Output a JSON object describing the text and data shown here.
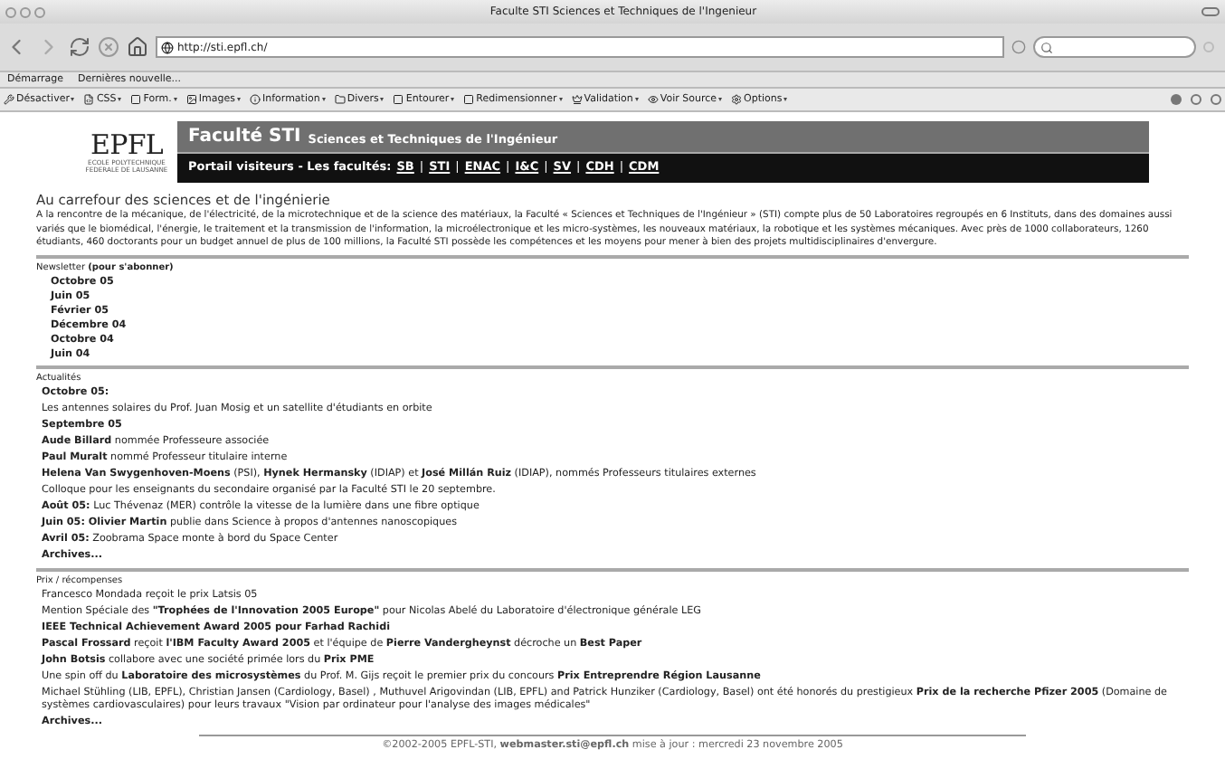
{
  "window": {
    "title": "Faculte STI Sciences et Techniques de l'Ingenieur"
  },
  "toolbar": {
    "url": "http://sti.epfl.ch/"
  },
  "bookmarks": [
    "Démarrage",
    "Dernières nouvelle..."
  ],
  "dev_toolbar": [
    "Désactiver",
    "CSS",
    "Form.",
    "Images",
    "Information",
    "Divers",
    "Entourer",
    "Redimensionner",
    "Validation",
    "Voir Source",
    "Options"
  ],
  "header": {
    "logo": "EPFL",
    "logo_caption": [
      "ECOLE POLYTECHNIQUE",
      "FEDERALE DE LAUSANNE"
    ],
    "title": "Faculté STI",
    "subtitle": "Sciences et Techniques de l'Ingénieur",
    "portal": "Portail visiteurs - Les facultés:",
    "links": [
      "SB",
      "STI",
      "ENAC",
      "I&C",
      "SV",
      "CDH",
      "CDM"
    ],
    "separators": [
      "|",
      "|",
      "|",
      "|",
      "|",
      "|"
    ]
  },
  "intro": {
    "heading": "Au carrefour des sciences et de l'ingénierie",
    "text": "A la rencontre de la mécanique, de l'électricité, de la microtechnique et de la science des matériaux, la Faculté « Sciences et Techniques de l'Ingénieur » (STI) compte plus de 50 Laboratoires regroupés en 6 Instituts, dans des domaines aussi variés que le biomédical, l'énergie, le traitement et la transmission de l'information, la microélectronique et les micro-systèmes, les nouveaux matériaux, la robotique et les systèmes mécaniques. Avec près de 1000 collaborateurs, 1260 étudiants, 460 doctorants pour un budget annuel de plus de 100 millions, la Faculté STI possède les compétences et les moyens pour mener à bien des projets multidisciplinaires d'envergure."
  },
  "sections": [
    {
      "title": "Newsletter **(pour s'abonner)**",
      "items": [
        {
          "kind": "link",
          "text": "Octobre 05"
        },
        {
          "kind": "link",
          "text": "Juin 05"
        },
        {
          "kind": "link",
          "text": "Février 05"
        },
        {
          "kind": "link",
          "text": "Décembre 04"
        },
        {
          "kind": "link",
          "text": "Octobre 04"
        },
        {
          "kind": "link",
          "text": "Juin 04"
        }
      ]
    },
    {
      "title": "Actualités",
      "items": [
        {
          "kind": "heading",
          "text": "**Octobre 05:**"
        },
        {
          "kind": "news",
          "text": "Les antennes solaires du Prof. Juan Mosig et un satellite d'étudiants en orbite"
        },
        {
          "kind": "heading",
          "text": "**Septembre 05**"
        },
        {
          "kind": "news",
          "text": "**Aude Billard** nommée Professeure associée"
        },
        {
          "kind": "news",
          "text": "**Paul Muralt** nommé Professeur titulaire interne"
        },
        {
          "kind": "news",
          "text": "**Helena Van Swygenhoven-Moens** (PSI), **Hynek Hermansky** (IDIAP) et **José Millán Ruiz** (IDIAP), nommés Professeurs titulaires externes"
        },
        {
          "kind": "news",
          "text": "Colloque pour les enseignants du secondaire organisé par la Faculté STI le 20 septembre."
        },
        {
          "kind": "news",
          "text": "**Août 05:** Luc Thévenaz (MER) contrôle la vitesse de la lumière dans une fibre optique"
        },
        {
          "kind": "news",
          "text": "**Juin 05: Olivier Martin** publie dans Science à propos d'antennes nanoscopiques"
        },
        {
          "kind": "news",
          "text": "**Avril 05:** Zoobrama Space monte à bord du Space Center"
        },
        {
          "kind": "archive",
          "text": "**Archives...**"
        }
      ]
    },
    {
      "title": "Prix / récompenses",
      "items": [
        {
          "kind": "news",
          "text": "Francesco Mondada reçoit le prix Latsis 05"
        },
        {
          "kind": "news",
          "text": "Mention Spéciale des **\"Trophées de l'Innovation 2005 Europe\"** pour Nicolas Abelé du Laboratoire d'électronique générale LEG"
        },
        {
          "kind": "news",
          "text": "**IEEE Technical Achievement Award 2005 pour Farhad Rachidi**"
        },
        {
          "kind": "news",
          "text": "**Pascal Frossard** reçoit **l'IBM Faculty Award 2005** et l'équipe de **Pierre Vandergheynst** décroche un **Best Paper**"
        },
        {
          "kind": "news",
          "text": "**John Botsis** collabore avec une société primée lors du **Prix PME**"
        },
        {
          "kind": "news",
          "text": "Une spin off du **Laboratoire des microsystèmes** du Prof. M. Gijs reçoit le premier prix du concours **Prix Entreprendre Région Lausanne**"
        },
        {
          "kind": "news",
          "text": "Michael Stühling (LIB, EPFL), Christian Jansen (Cardiology, Basel) , Muthuvel Arigovindan (LIB, EPFL) and Patrick Hunziker (Cardiology, Basel) ont été honorés du prestigieux **Prix de la recherche Pfizer 2005** (Domaine de systèmes cardiovasculaires) pour leurs travaux \"Vision par ordinateur pour l'analyse des images médicales\""
        },
        {
          "kind": "archive",
          "text": "**Archives...**"
        }
      ]
    }
  ],
  "footer": "©2002-2005 EPFL-STI, **webmaster.sti@epfl.ch** mise à jour : mercredi 23 novembre 2005"
}
